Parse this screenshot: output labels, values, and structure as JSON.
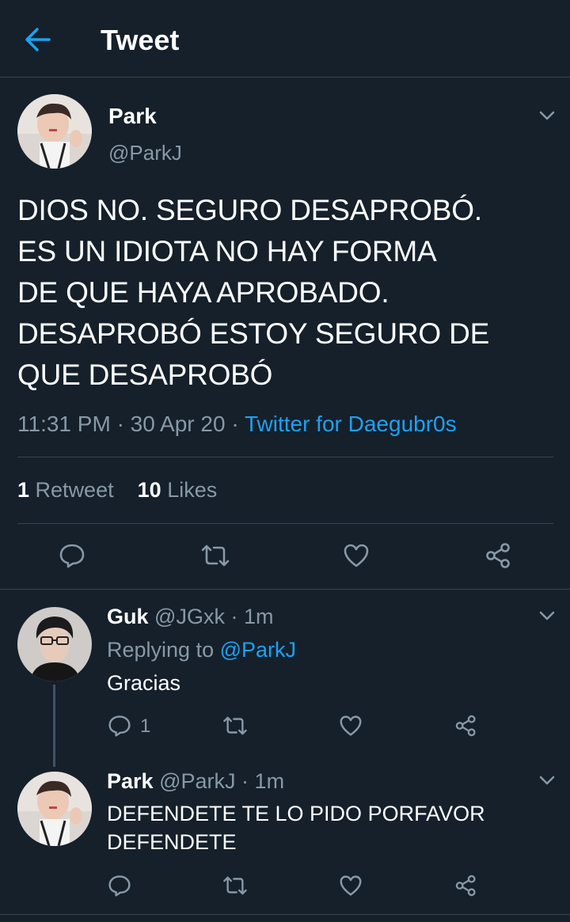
{
  "header": {
    "title": "Tweet",
    "back_icon": "arrow-left-icon",
    "accent": "#1da1f2"
  },
  "tweet": {
    "name": "Park",
    "handle": "@ParkJ",
    "lines": [
      "DIOS NO. SEGURO DESAPROBÓ.",
      "ES UN IDIOTA NO HAY FORMA",
      "DE QUE HAYA APROBADO.",
      "DESAPROBÓ ESTOY SEGURO DE",
      "QUE DESAPROBÓ"
    ],
    "time": "11:31 PM",
    "sep1": "·",
    "date": "30 Apr 20",
    "sep2": "·",
    "source": "Twitter for Daegubr0s",
    "retweet_count": "1",
    "retweet_label": "Retweet",
    "likes_count": "10",
    "likes_label": "Likes"
  },
  "replies": [
    {
      "name": "Guk",
      "handle": "@JGxk",
      "sep": "·",
      "time": "1m",
      "replying_label": "Replying to",
      "replying_to": "@ParkJ",
      "text": "Gracias",
      "reply_count": "1"
    },
    {
      "name": "Park",
      "handle": "@ParkJ",
      "sep": "·",
      "time": "1m",
      "lines": [
        "DEFENDETE TE LO PIDO PORFAVOR",
        "DEFENDETE"
      ]
    }
  ],
  "colors": {
    "background": "#15202b",
    "secondary_text": "#8899a6",
    "divider": "#38444d",
    "link": "#1da1f2"
  }
}
